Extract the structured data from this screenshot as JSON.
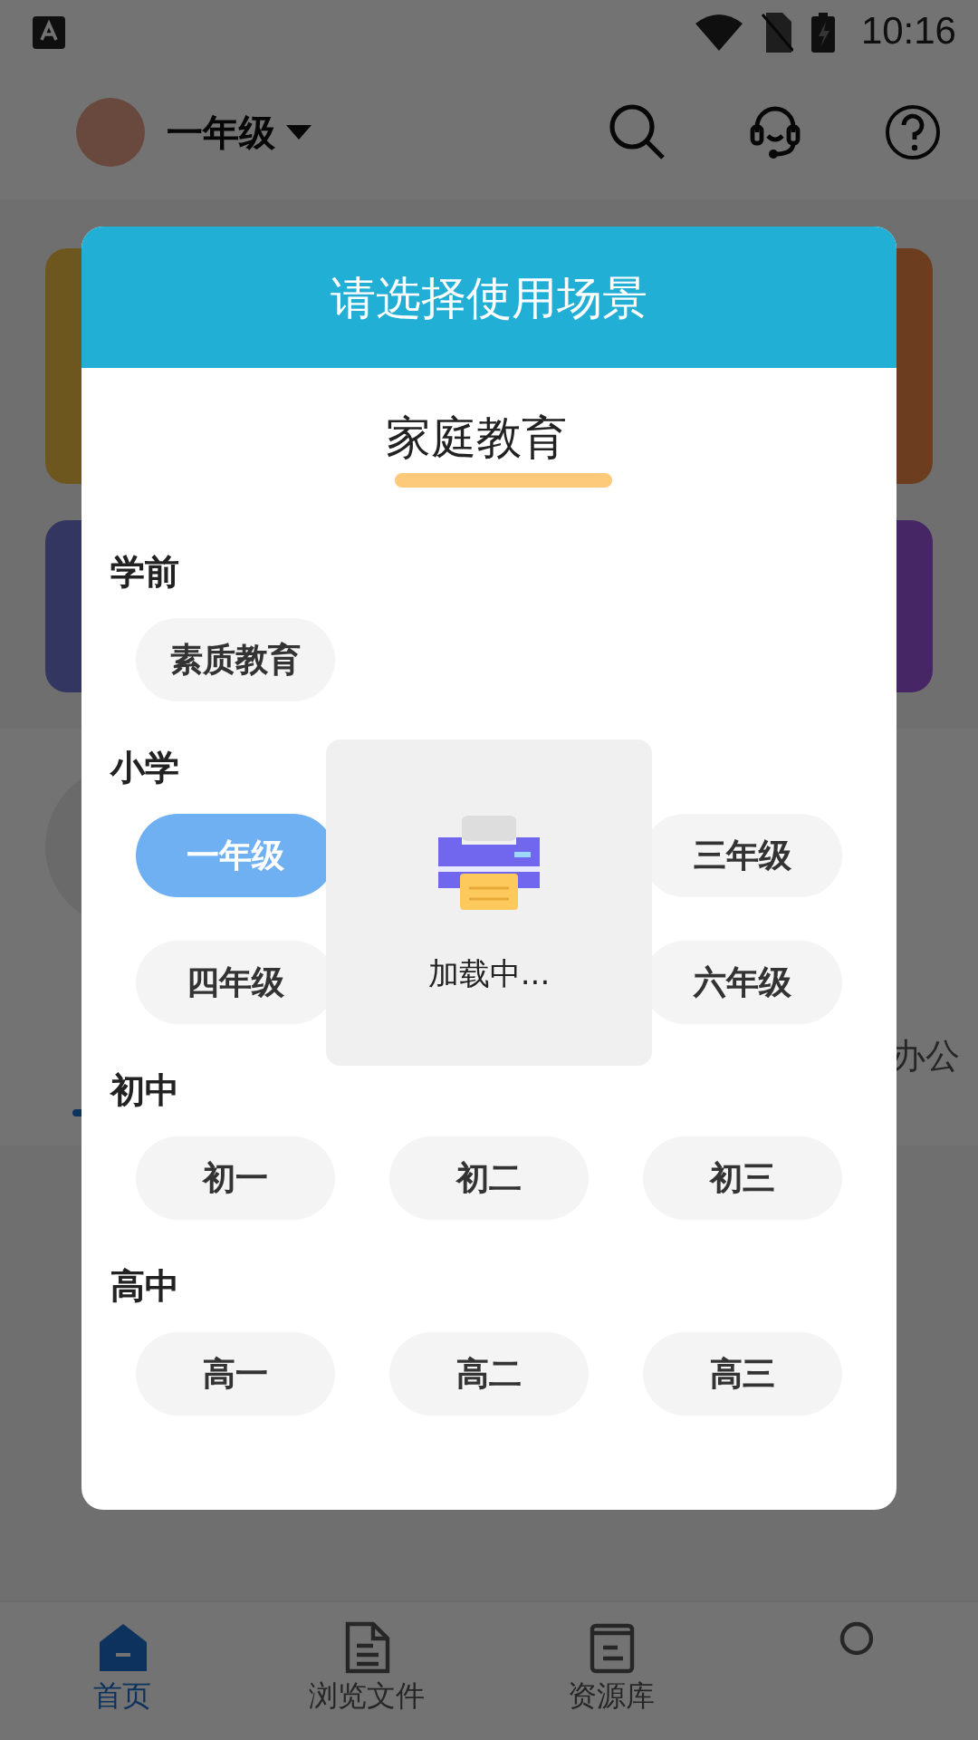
{
  "status_bar": {
    "time": "10:16"
  },
  "header": {
    "grade": "一年级"
  },
  "recommend": {
    "tab": "办公"
  },
  "nav": [
    {
      "kind": "home",
      "label": "首页",
      "selected": true
    },
    {
      "kind": "file",
      "label": "浏览文件",
      "selected": false
    },
    {
      "kind": "book",
      "label": "资源库",
      "selected": false
    },
    {
      "kind": "person",
      "selected": false
    }
  ],
  "dialog": {
    "title": "请选择使用场景",
    "scene": "家庭教育",
    "sections": [
      {
        "title": "学前",
        "chips": [
          {
            "kind": "chip",
            "label": "素质教育",
            "selected": false
          }
        ]
      },
      {
        "title": "小学",
        "chips": [
          {
            "kind": "chip",
            "label": "一年级",
            "selected": true
          },
          {
            "kind": "covered"
          },
          {
            "kind": "chip",
            "label": "三年级",
            "selected": false
          },
          {
            "kind": "chip",
            "label": "四年级",
            "selected": false
          },
          {
            "kind": "covered"
          },
          {
            "kind": "chip",
            "label": "六年级",
            "selected": false
          }
        ]
      },
      {
        "title": "初中",
        "chips": [
          {
            "kind": "chip",
            "label": "初一",
            "selected": false
          },
          {
            "kind": "chip",
            "label": "初二",
            "selected": false
          },
          {
            "kind": "chip",
            "label": "初三",
            "selected": false
          }
        ]
      },
      {
        "title": "高中",
        "chips": [
          {
            "kind": "chip",
            "label": "高一",
            "selected": false
          },
          {
            "kind": "chip",
            "label": "高二",
            "selected": false
          },
          {
            "kind": "chip",
            "label": "高三",
            "selected": false
          }
        ]
      }
    ],
    "loading": {
      "text": "加载中..."
    }
  }
}
